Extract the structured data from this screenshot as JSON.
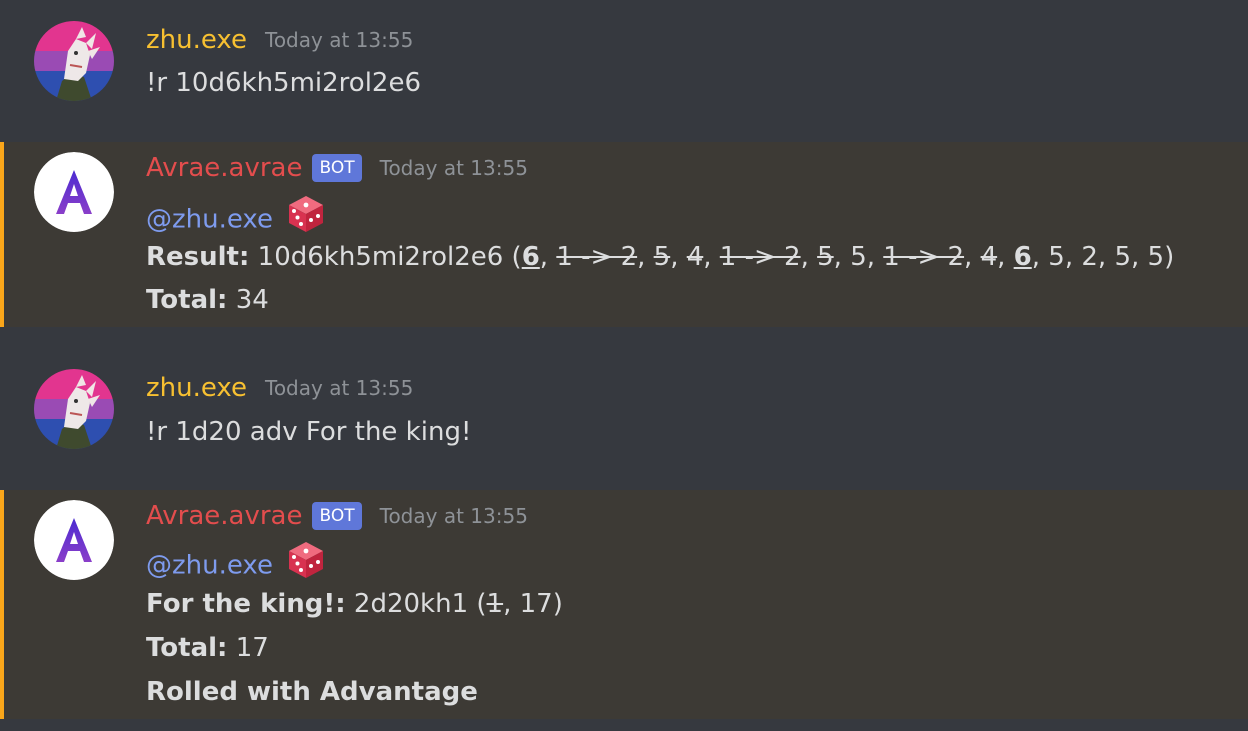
{
  "messages": [
    {
      "author": "zhu.exe",
      "timestamp": "Today at 13:55",
      "text": "!r 10d6kh5mi2rol2e6"
    },
    {
      "author": "Avrae.avrae",
      "bot_tag": "BOT",
      "timestamp": "Today at 13:55",
      "mention": "@zhu.exe",
      "result_label": "Result:",
      "result_expr": " 10d6kh5mi2rol2e6 (",
      "result_dice": [
        {
          "text": "6",
          "style": "kept"
        },
        {
          "text": "1 -> 2",
          "style": "dropped"
        },
        {
          "text": "5",
          "style": "dropped"
        },
        {
          "text": "4",
          "style": "dropped"
        },
        {
          "text": "1 -> 2",
          "style": "dropped"
        },
        {
          "text": "5",
          "style": "dropped"
        },
        {
          "text": "5",
          "style": "normal"
        },
        {
          "text": "1 -> 2",
          "style": "dropped"
        },
        {
          "text": "4",
          "style": "dropped"
        },
        {
          "text": "6",
          "style": "kept"
        },
        {
          "text": "5",
          "style": "normal"
        },
        {
          "text": "2",
          "style": "normal"
        },
        {
          "text": "5",
          "style": "normal"
        },
        {
          "text": "5",
          "style": "normal"
        }
      ],
      "total_label": "Total:",
      "total_value": " 34"
    },
    {
      "author": "zhu.exe",
      "timestamp": "Today at 13:55",
      "text": "!r 1d20 adv For the king!"
    },
    {
      "author": "Avrae.avrae",
      "bot_tag": "BOT",
      "timestamp": "Today at 13:55",
      "mention": "@zhu.exe",
      "result_label": "For the king!:",
      "result_expr": " 2d20kh1 (",
      "result_dice": [
        {
          "text": "1",
          "style": "dropped"
        },
        {
          "text": "17",
          "style": "normal"
        }
      ],
      "total_label": "Total:",
      "total_value": " 17",
      "footer": "Rolled with Advantage"
    }
  ],
  "colors": {
    "background": "#36393f",
    "mention_background": "#3d3a35",
    "mention_border": "#faa61a",
    "user_name": "#f7c031",
    "bot_name": "#e34d4d",
    "bot_tag": "#5f77d9",
    "mention_text": "#7e9bee"
  },
  "icons": {
    "user_avatar": "dragon-avatar-icon",
    "bot_avatar": "avrae-logo-icon",
    "reaction": "game-die-icon"
  }
}
